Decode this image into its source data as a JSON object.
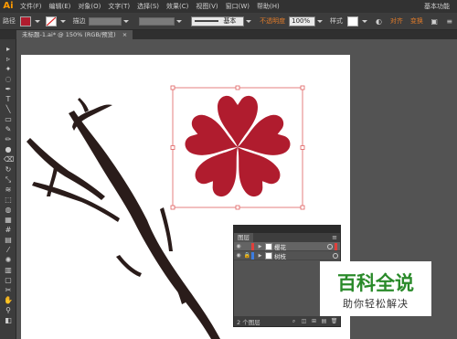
{
  "app": {
    "logo": "Ai",
    "menu": [
      "文件(F)",
      "编辑(E)",
      "对象(O)",
      "文字(T)",
      "选择(S)",
      "效果(C)",
      "视图(V)",
      "窗口(W)",
      "帮助(H)"
    ],
    "workspace": "基本功能"
  },
  "control_bar": {
    "selection_label": "路径",
    "stroke_label": "描边",
    "stroke_style": "基本",
    "opacity_label": "不透明度",
    "opacity_value": "100%",
    "style_label": "样式",
    "align_link": "对齐",
    "transform_link": "变换",
    "fill_color": "#b01c2e",
    "accent_color": "#e07b2a"
  },
  "document": {
    "tab_title": "未标题-1.ai* @ 150% (RGB/预览)",
    "close_glyph": "×"
  },
  "tools": [
    "selection-tool",
    "direct-selection-tool",
    "magic-wand-tool",
    "lasso-tool",
    "pen-tool",
    "type-tool",
    "line-tool",
    "rectangle-tool",
    "paintbrush-tool",
    "pencil-tool",
    "blob-brush-tool",
    "eraser-tool",
    "rotate-tool",
    "scale-tool",
    "width-tool",
    "free-transform-tool",
    "shape-builder-tool",
    "perspective-tool",
    "mesh-tool",
    "gradient-tool",
    "eyedropper-tool",
    "symbol-sprayer-tool",
    "column-graph-tool",
    "artboard-tool",
    "slice-tool",
    "hand-tool",
    "zoom-tool",
    "fill-stroke-swatch"
  ],
  "layers_panel": {
    "tab": "图层",
    "layers": [
      {
        "name": "樱花",
        "color": "#e0403c",
        "selected": true
      },
      {
        "name": "树枝",
        "color": "#3c7ce0",
        "selected": false
      }
    ],
    "footer_count": "2 个图层"
  },
  "artwork": {
    "flower_color": "#b01c2e",
    "branch_color": "#2a1c1a",
    "selection_color": "#e06060"
  },
  "watermark": {
    "title": "百科全说",
    "subtitle": "助你轻松解决",
    "title_color": "#2a8a2a"
  }
}
